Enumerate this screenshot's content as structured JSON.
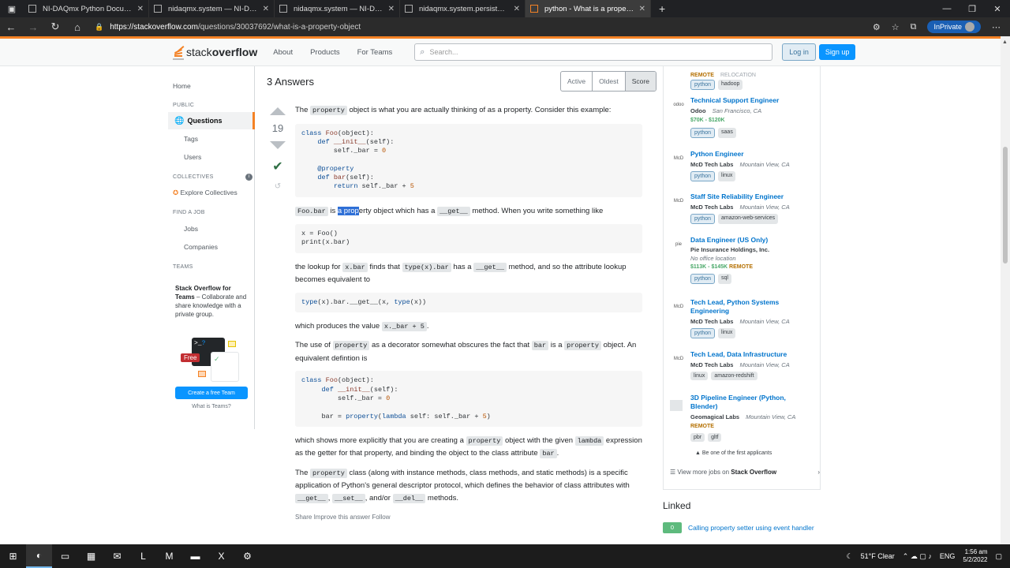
{
  "browser": {
    "tabs": [
      {
        "title": "NI-DAQmx Python Documentatio",
        "active": false
      },
      {
        "title": "nidaqmx.system — NI-DAQmx P",
        "active": false
      },
      {
        "title": "nidaqmx.system — NI-DAQmx P",
        "active": false
      },
      {
        "title": "nidaqmx.system.persisted_task_c",
        "active": false
      },
      {
        "title": "python - What is a property obje",
        "active": true
      }
    ],
    "url_host": "https://stackoverflow.com",
    "url_path": "/questions/30037692/what-is-a-property-object",
    "inprivate": "InPrivate"
  },
  "site": {
    "logo_stack": "stack",
    "logo_overflow": "overflow",
    "nav": [
      "About",
      "Products",
      "For Teams"
    ],
    "search_placeholder": "Search...",
    "login": "Log in",
    "signup": "Sign up"
  },
  "leftnav": {
    "home": "Home",
    "public": "PUBLIC",
    "questions": "Questions",
    "tags": "Tags",
    "users": "Users",
    "collectives": "COLLECTIVES",
    "explore": "Explore Collectives",
    "findjob": "FIND A JOB",
    "jobs": "Jobs",
    "companies": "Companies",
    "teams": "TEAMS",
    "teams_title": "Stack Overflow for Teams",
    "teams_desc": " – Collaborate and share knowledge with a private group.",
    "free": "Free",
    "create": "Create a free Team",
    "whatis": "What is Teams?"
  },
  "answers": {
    "heading": "3 Answers",
    "sort": [
      "Active",
      "Oldest",
      "Score"
    ],
    "score": "19",
    "footer": "Share  Improve this answer  Follow"
  },
  "sidebar": {
    "top_remote": "REMOTE",
    "top_reloc": "RELOCATION",
    "top_tags": [
      "python",
      "hadoop"
    ],
    "jobs": [
      {
        "title": "Technical Support Engineer",
        "company": "Odoo",
        "location": "San Francisco, CA",
        "salary": "$70K - $120K",
        "tags": [
          "python",
          "saas"
        ],
        "logo": "odoo"
      },
      {
        "title": "Python Engineer",
        "company": "McD Tech Labs",
        "location": "Mountain View, CA",
        "tags": [
          "python",
          "linux"
        ],
        "logo": "McD"
      },
      {
        "title": "Staff Site Reliability Engineer",
        "company": "McD Tech Labs",
        "location": "Mountain View, CA",
        "tags": [
          "python",
          "amazon-web-services"
        ],
        "logo": "McD"
      },
      {
        "title": "Data Engineer (US Only)",
        "company": "Pie Insurance Holdings, Inc.",
        "location": "No office location",
        "salary": "$113K - $145K",
        "remote": "REMOTE",
        "tags": [
          "python",
          "sql"
        ],
        "logo": "pie"
      },
      {
        "title": "Tech Lead, Python Systems Engineering",
        "company": "McD Tech Labs",
        "location": "Mountain View, CA",
        "tags": [
          "python",
          "linux"
        ],
        "logo": "McD"
      },
      {
        "title": "Tech Lead, Data Infrastructure",
        "company": "McD Tech Labs",
        "location": "Mountain View, CA",
        "tags": [
          "linux",
          "amazon-redshift"
        ],
        "logo": "McD"
      },
      {
        "title": "3D Pipeline Engineer (Python, Blender)",
        "company": "Geomagical Labs",
        "location": "Mountain View, CA",
        "remote": "REMOTE",
        "tags": [
          "pbr",
          "gltf"
        ],
        "logo": ""
      }
    ],
    "first_applicants": "Be one of the first applicants",
    "view_more": "View more jobs on ",
    "view_more_bold": "Stack Overflow"
  },
  "linked": {
    "heading": "Linked",
    "items": [
      {
        "count": "0",
        "title": "Calling property setter using event handler"
      }
    ]
  },
  "taskbar": {
    "weather": "51°F  Clear",
    "lang": "ENG",
    "time": "1:56 am",
    "date": "5/2/2022"
  }
}
